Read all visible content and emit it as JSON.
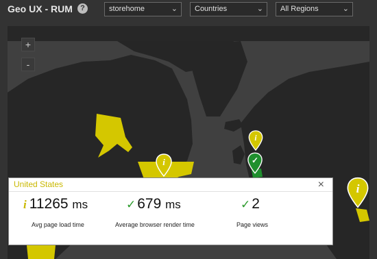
{
  "header": {
    "title": "Geo UX - RUM",
    "help_symbol": "?",
    "filters": [
      {
        "value": "storehome"
      },
      {
        "value": "Countries"
      },
      {
        "value": "All Regions"
      }
    ],
    "chevron": "⌄"
  },
  "map": {
    "zoom_in": "+",
    "zoom_out": "-",
    "pin_symbol_info": "i",
    "pin_symbol_ok": "✓",
    "colors": {
      "land": "#262626",
      "ocean": "#404040",
      "highlight": "#d4c700",
      "ok": "#1f8f2e"
    }
  },
  "tooltip": {
    "country": "United States",
    "close_symbol": "×",
    "metrics": [
      {
        "icon": "info-icon",
        "symbol": "i",
        "value": "11265",
        "unit": "ms",
        "label": "Avg page load time"
      },
      {
        "icon": "check-icon",
        "symbol": "✓",
        "value": "679",
        "unit": "ms",
        "label": "Average browser render time"
      },
      {
        "icon": "check-icon",
        "symbol": "✓",
        "value": "2",
        "unit": "",
        "label": "Page views"
      }
    ]
  }
}
